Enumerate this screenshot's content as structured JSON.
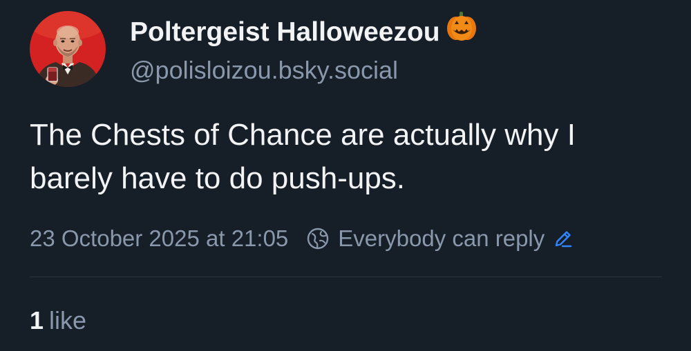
{
  "author": {
    "display_name": "Poltergeist Halloweezou",
    "emoji": "jack-o-lantern-icon",
    "handle": "@polisloizou.bsky.social",
    "avatar": "profile-avatar"
  },
  "post": {
    "text": "The Chests of Chance are actually why I barely have to do push-ups.",
    "timestamp": "23 October 2025 at 21:05",
    "reply_setting": "Everybody can reply"
  },
  "stats": {
    "like_count": "1",
    "like_label": "like"
  },
  "colors": {
    "background": "#161e27",
    "text_primary": "#f1f3f5",
    "text_secondary": "#8a98ab",
    "divider": "#2b3542",
    "accent_link": "#2f86ff",
    "avatar_bg": "#d42222",
    "pumpkin": "#f28a16"
  }
}
